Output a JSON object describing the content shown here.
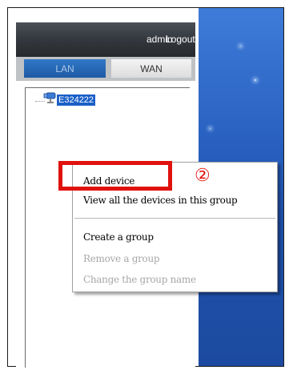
{
  "header": {
    "user": "admin",
    "logout_label": "Logout"
  },
  "tabs": [
    {
      "label": "LAN",
      "active": true
    },
    {
      "label": "WAN",
      "active": false
    }
  ],
  "tree": {
    "device_label": "E324222",
    "device_icon": "camera-icon"
  },
  "context_menu": {
    "items": [
      {
        "label": "Add device",
        "enabled": true
      },
      {
        "label": "View all the devices in this group",
        "enabled": true
      },
      {
        "label": "Create a group",
        "enabled": true
      },
      {
        "label": "Remove a group",
        "enabled": false
      },
      {
        "label": "Change the group name",
        "enabled": false
      }
    ]
  },
  "annotation": {
    "step": "②",
    "color": "#e0120e"
  }
}
